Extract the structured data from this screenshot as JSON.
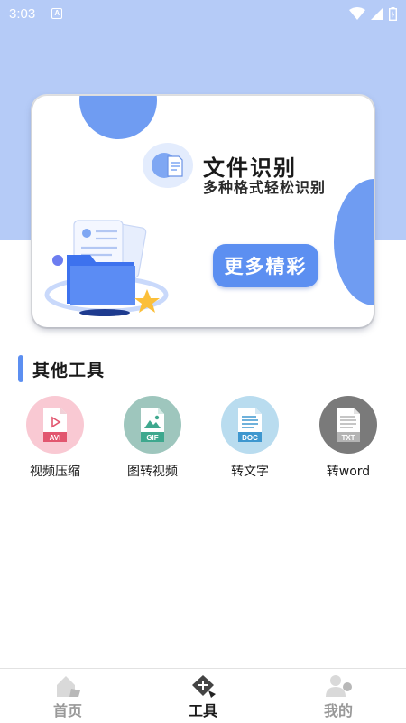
{
  "status_bar": {
    "time": "3:03",
    "notification_letter": "A"
  },
  "banner": {
    "title": "文件识别",
    "subtitle": "多种格式轻松识别",
    "button_label": "更多精彩"
  },
  "section": {
    "title": "其他工具"
  },
  "tools": [
    {
      "label": "视频压缩",
      "badge": "AVI",
      "icon": "avi-file-icon",
      "bg": "#f9c9d3",
      "color": "#e2566f"
    },
    {
      "label": "图转视频",
      "badge": "GIF",
      "icon": "gif-file-icon",
      "bg": "#9ec6bd",
      "color": "#3ea88e"
    },
    {
      "label": "转文字",
      "badge": "DOC",
      "icon": "doc-file-icon",
      "bg": "#b9dcef",
      "color": "#3e97cf"
    },
    {
      "label": "转word",
      "badge": "TXT",
      "icon": "txt-file-icon",
      "bg": "#7a7a7a",
      "color": "#b4b4b4"
    }
  ],
  "bottom_nav": [
    {
      "label": "首页",
      "icon": "home-icon",
      "active": false
    },
    {
      "label": "工具",
      "icon": "tools-icon",
      "active": true
    },
    {
      "label": "我的",
      "icon": "profile-icon",
      "active": false
    }
  ],
  "colors": {
    "accent": "#5c8ff1",
    "header_bg": "#b5cbf7"
  }
}
